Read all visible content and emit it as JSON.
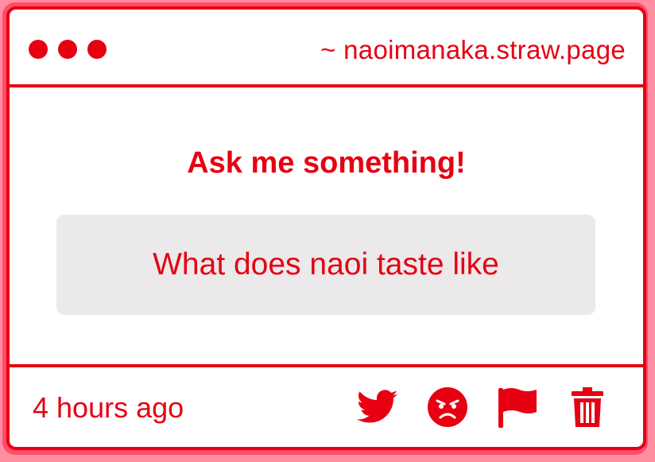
{
  "window": {
    "url": "~ naoimanaka.straw.page"
  },
  "main": {
    "heading": "Ask me something!",
    "question": "What does naoi taste like"
  },
  "footer": {
    "timestamp": "4 hours ago",
    "actions": [
      "twitter-icon",
      "angry-face-icon",
      "flag-icon",
      "trash-icon"
    ]
  },
  "colors": {
    "accent": "#e60012",
    "outer_background": "#ff8fa0",
    "question_background": "#ebe9ea"
  }
}
